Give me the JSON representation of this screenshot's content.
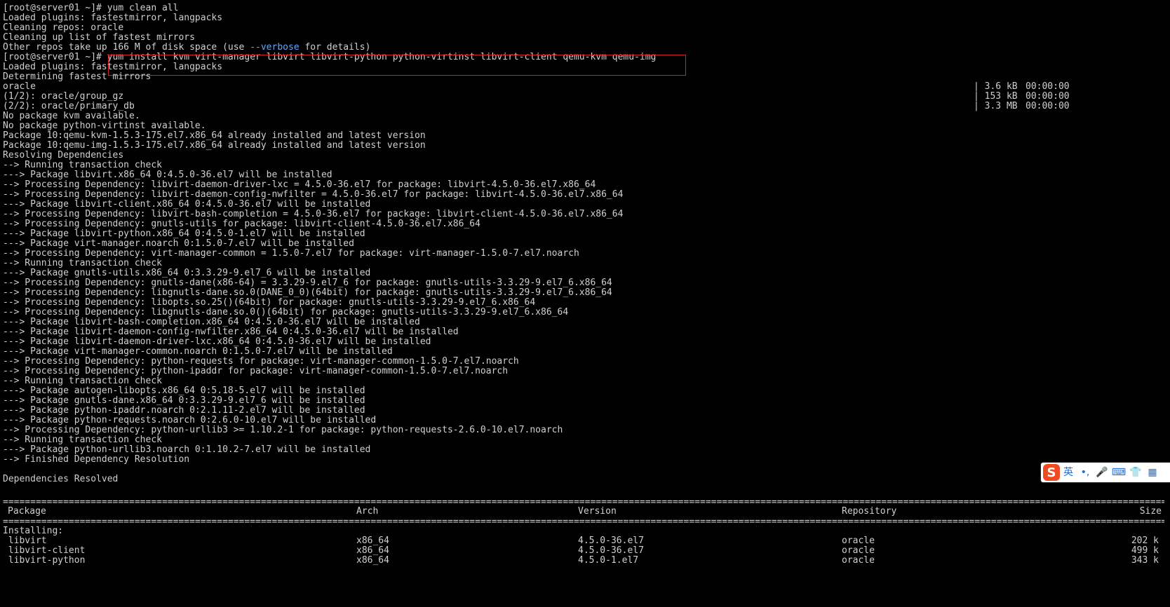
{
  "pre_lines": [
    "[root@server01 ~]# yum clean all",
    "Loaded plugins: fastestmirror, langpacks",
    "Cleaning repos: oracle",
    "Cleaning up list of fastest mirrors"
  ],
  "disk_line": {
    "before": "Other repos take up 166 M of disk space (use ",
    "flag": "--verbose",
    "after": " for details)"
  },
  "prompt": "[root@server01 ~]# ",
  "command": "yum install kvm virt-manager libvirt libvirt-python python-virtinst libvirt-client qemu-kvm qemu-img",
  "lines": [
    "Loaded plugins: fastestmirror, langpacks",
    "Determining fastest mirrors",
    "oracle",
    "(1/2): oracle/group_gz",
    "(2/2): oracle/primary_db",
    "No package kvm available.",
    "No package python-virtinst available.",
    "Package 10:qemu-kvm-1.5.3-175.el7.x86_64 already installed and latest version",
    "Package 10:qemu-img-1.5.3-175.el7.x86_64 already installed and latest version",
    "Resolving Dependencies",
    "--> Running transaction check",
    "---> Package libvirt.x86_64 0:4.5.0-36.el7 will be installed",
    "--> Processing Dependency: libvirt-daemon-driver-lxc = 4.5.0-36.el7 for package: libvirt-4.5.0-36.el7.x86_64",
    "--> Processing Dependency: libvirt-daemon-config-nwfilter = 4.5.0-36.el7 for package: libvirt-4.5.0-36.el7.x86_64",
    "---> Package libvirt-client.x86_64 0:4.5.0-36.el7 will be installed",
    "--> Processing Dependency: libvirt-bash-completion = 4.5.0-36.el7 for package: libvirt-client-4.5.0-36.el7.x86_64",
    "--> Processing Dependency: gnutls-utils for package: libvirt-client-4.5.0-36.el7.x86_64",
    "---> Package libvirt-python.x86_64 0:4.5.0-1.el7 will be installed",
    "---> Package virt-manager.noarch 0:1.5.0-7.el7 will be installed",
    "--> Processing Dependency: virt-manager-common = 1.5.0-7.el7 for package: virt-manager-1.5.0-7.el7.noarch",
    "--> Running transaction check",
    "---> Package gnutls-utils.x86_64 0:3.3.29-9.el7_6 will be installed",
    "--> Processing Dependency: gnutls-dane(x86-64) = 3.3.29-9.el7_6 for package: gnutls-utils-3.3.29-9.el7_6.x86_64",
    "--> Processing Dependency: libgnutls-dane.so.0(DANE_0_0)(64bit) for package: gnutls-utils-3.3.29-9.el7_6.x86_64",
    "--> Processing Dependency: libopts.so.25()(64bit) for package: gnutls-utils-3.3.29-9.el7_6.x86_64",
    "--> Processing Dependency: libgnutls-dane.so.0()(64bit) for package: gnutls-utils-3.3.29-9.el7_6.x86_64",
    "---> Package libvirt-bash-completion.x86_64 0:4.5.0-36.el7 will be installed",
    "---> Package libvirt-daemon-config-nwfilter.x86_64 0:4.5.0-36.el7 will be installed",
    "---> Package libvirt-daemon-driver-lxc.x86_64 0:4.5.0-36.el7 will be installed",
    "---> Package virt-manager-common.noarch 0:1.5.0-7.el7 will be installed",
    "--> Processing Dependency: python-requests for package: virt-manager-common-1.5.0-7.el7.noarch",
    "--> Processing Dependency: python-ipaddr for package: virt-manager-common-1.5.0-7.el7.noarch",
    "--> Running transaction check",
    "---> Package autogen-libopts.x86_64 0:5.18-5.el7 will be installed",
    "---> Package gnutls-dane.x86_64 0:3.3.29-9.el7_6 will be installed",
    "---> Package python-ipaddr.noarch 0:2.1.11-2.el7 will be installed",
    "---> Package python-requests.noarch 0:2.6.0-10.el7 will be installed",
    "--> Processing Dependency: python-urllib3 >= 1.10.2-1 for package: python-requests-2.6.0-10.el7.noarch",
    "--> Running transaction check",
    "---> Package python-urllib3.noarch 0:1.10.2-7.el7 will be installed",
    "--> Finished Dependency Resolution",
    "",
    "Dependencies Resolved"
  ],
  "downloads": [
    {
      "size": "| 3.6 kB",
      "time": "00:00:00"
    },
    {
      "size": "| 153 kB",
      "time": "00:00:00"
    },
    {
      "size": "| 3.3 MB",
      "time": "00:00:00"
    }
  ],
  "rule_char": "================================================================================================================================================================================================================================================================",
  "table": {
    "headers": {
      "package": "Package",
      "arch": "Arch",
      "version": "Version",
      "repository": "Repository",
      "size": "Size"
    },
    "section": "Installing:",
    "rows": [
      {
        "package": " libvirt",
        "arch": "x86_64",
        "version": "4.5.0-36.el7",
        "repository": "oracle",
        "size": "202 k"
      },
      {
        "package": " libvirt-client",
        "arch": "x86_64",
        "version": "4.5.0-36.el7",
        "repository": "oracle",
        "size": "499 k"
      },
      {
        "package": " libvirt-python",
        "arch": "x86_64",
        "version": "4.5.0-1.el7",
        "repository": "oracle",
        "size": "343 k"
      }
    ]
  },
  "ime": {
    "logo": "S",
    "mode": "英",
    "punct": "•,",
    "mic": "🎤",
    "keyboard": "⌨",
    "skin": "👕",
    "tools": "▦"
  }
}
